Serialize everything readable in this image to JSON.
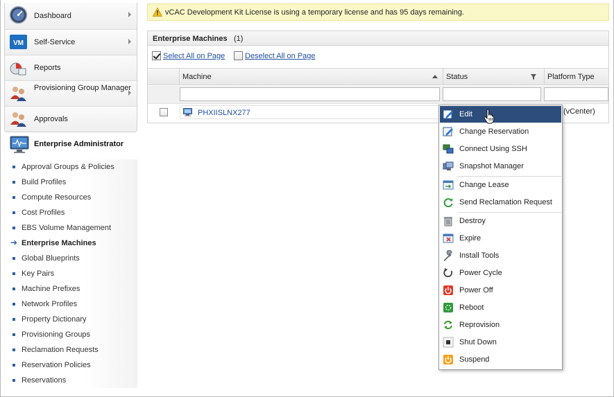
{
  "sidebar": {
    "nav_items": [
      {
        "label": "Dashboard",
        "icon": "dashboard-gauge-icon",
        "has_submenu": true
      },
      {
        "label": "Self-Service",
        "icon": "vm-icon",
        "has_submenu": true
      },
      {
        "label": "Reports",
        "icon": "reports-icon",
        "has_submenu": false
      },
      {
        "label": "Provisioning Group Manager",
        "icon": "users-icon",
        "has_submenu": true
      },
      {
        "label": "Approvals",
        "icon": "approvals-icon",
        "has_submenu": false
      }
    ],
    "admin_section": {
      "label": "Enterprise Administrator",
      "icon": "monitor-icon"
    },
    "sub_items": [
      {
        "label": "Approval Groups & Policies"
      },
      {
        "label": "Build Profiles"
      },
      {
        "label": "Compute Resources"
      },
      {
        "label": "Cost Profiles"
      },
      {
        "label": "EBS Volume Management"
      },
      {
        "label": "Enterprise Machines",
        "active": true
      },
      {
        "label": "Global Blueprints"
      },
      {
        "label": "Key Pairs"
      },
      {
        "label": "Machine Prefixes"
      },
      {
        "label": "Network Profiles"
      },
      {
        "label": "Property Dictionary"
      },
      {
        "label": "Provisioning Groups"
      },
      {
        "label": "Reclamation Requests"
      },
      {
        "label": "Reservation Policies"
      },
      {
        "label": "Reservations"
      }
    ]
  },
  "license_bar": {
    "text": "vCAC Development Kit License is using a temporary license and has 95 days remaining."
  },
  "machines_panel": {
    "title": "Enterprise Machines",
    "count": "(1)",
    "select_all_label": "Select All on Page",
    "deselect_all_label": "Deselect All on Page",
    "columns": [
      "Machine",
      "Status",
      "Platform Type"
    ],
    "rows": [
      {
        "machine": "PHXIISLNX277",
        "status": "",
        "platform": "ere (vCenter)"
      }
    ]
  },
  "context_menu": {
    "items": [
      {
        "label": "Edit",
        "icon": "edit-icon",
        "highlighted": true
      },
      {
        "label": "Change Reservation",
        "icon": "change-reservation-icon"
      },
      {
        "label": "Connect Using SSH",
        "icon": "ssh-terminal-icon"
      },
      {
        "label": "Snapshot Manager",
        "icon": "snapshot-icon"
      },
      {
        "label": "Change Lease",
        "icon": "change-lease-icon"
      },
      {
        "label": "Send Reclamation Request",
        "icon": "refresh-icon"
      },
      {
        "label": "Destroy",
        "icon": "trash-icon"
      },
      {
        "label": "Expire",
        "icon": "expire-icon"
      },
      {
        "label": "Install Tools",
        "icon": "wrench-icon"
      },
      {
        "label": "Power Cycle",
        "icon": "power-cycle-icon"
      },
      {
        "label": "Power Off",
        "icon": "power-off-icon"
      },
      {
        "label": "Reboot",
        "icon": "reboot-icon"
      },
      {
        "label": "Reprovision",
        "icon": "reprovision-icon"
      },
      {
        "label": "Shut Down",
        "icon": "shut-down-icon"
      },
      {
        "label": "Suspend",
        "icon": "suspend-icon"
      }
    ]
  },
  "colors": {
    "link": "#1f4fa0",
    "menu_highlight": "#2d4e7c",
    "license_bar_bg": "#fbf8c7"
  }
}
